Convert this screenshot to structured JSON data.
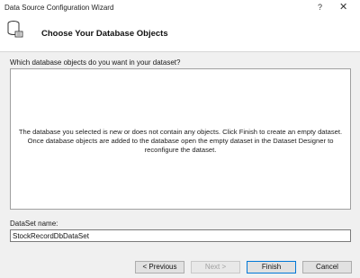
{
  "window": {
    "title": "Data Source Configuration Wizard",
    "help_glyph": "?",
    "close_glyph": "✕"
  },
  "header": {
    "icon": "database-icon",
    "title": "Choose Your Database Objects"
  },
  "main": {
    "prompt": "Which database objects do you want in your dataset?",
    "info_message": "The database you selected is new or does not contain any objects. Click Finish to create an empty dataset. Once database objects are added to the database open the empty dataset in the Dataset Designer to reconfigure the dataset."
  },
  "dataset": {
    "label": "DataSet name:",
    "value": "StockRecordDbDataSet"
  },
  "buttons": {
    "previous": "< Previous",
    "next": "Next >",
    "finish": "Finish",
    "cancel": "Cancel"
  }
}
